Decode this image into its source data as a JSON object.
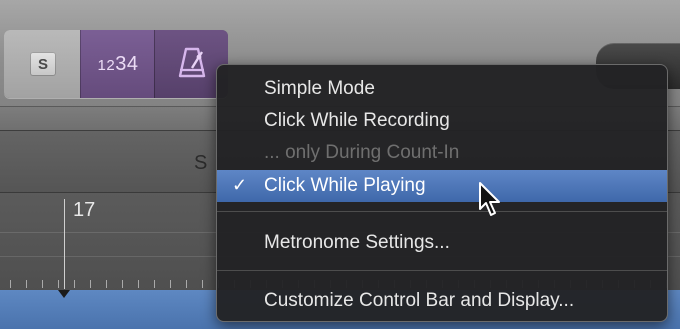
{
  "control_bar": {
    "solo_label": "S",
    "countin": {
      "small": "12",
      "large": "34"
    },
    "metronome_icon": "metronome-icon",
    "accent_purple": "#6d5383"
  },
  "ruler": {
    "section_label": "S",
    "bar_number": "17"
  },
  "menu": {
    "items": [
      {
        "label": "Simple Mode",
        "enabled": true,
        "checked": false
      },
      {
        "label": "Click While Recording",
        "enabled": true,
        "checked": false
      },
      {
        "label": "... only During Count-In",
        "enabled": false,
        "checked": false
      },
      {
        "label": "Click While Playing",
        "enabled": true,
        "checked": true,
        "highlighted": true
      },
      {
        "label": "Metronome Settings...",
        "enabled": true,
        "checked": false
      },
      {
        "label": "Customize Control Bar and Display...",
        "enabled": true,
        "checked": false
      }
    ],
    "check_mark": "✓",
    "highlight_color": "#4f77b8"
  }
}
